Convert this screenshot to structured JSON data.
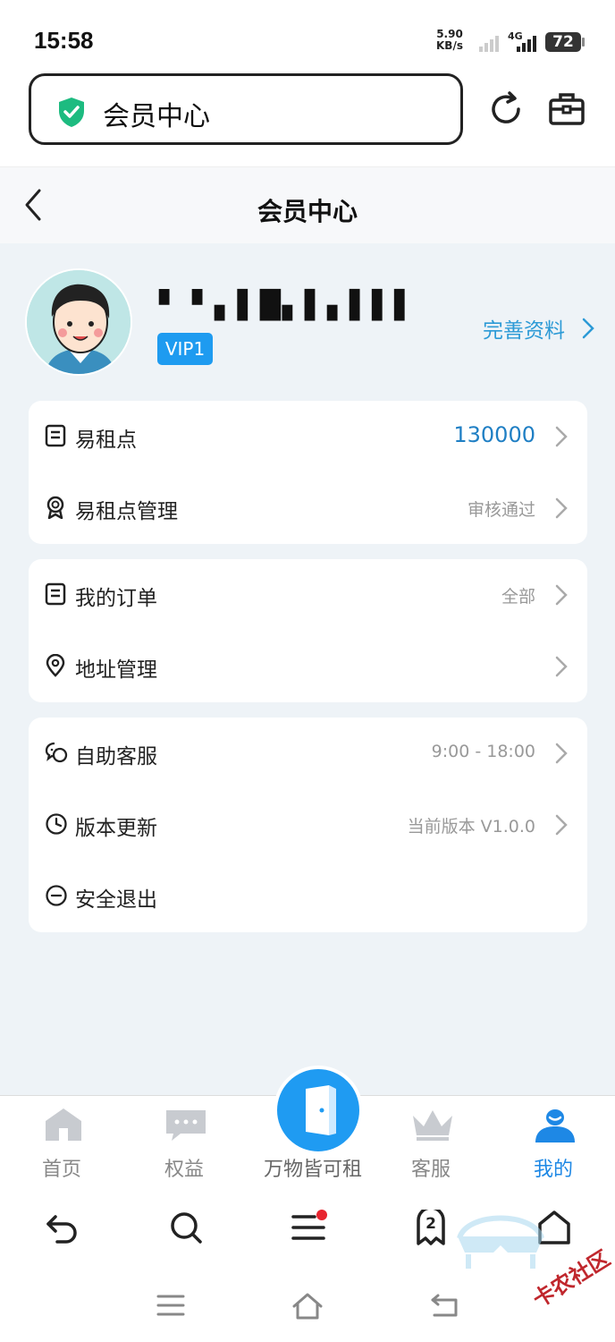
{
  "status_bar": {
    "time": "15:58",
    "speed_value": "5.90",
    "speed_unit": "KB/s",
    "network": "4G",
    "battery": "72"
  },
  "browser": {
    "address_text": "会员中心"
  },
  "header": {
    "title": "会员中心"
  },
  "profile": {
    "username": "▘▝▗ ▌█▖▌▖▌▌▌",
    "vip_badge": "VIP1",
    "complete_profile_link": "完善资料"
  },
  "card1": [
    {
      "label": "易租点",
      "value": "130000",
      "icon": "document-icon"
    },
    {
      "label": "易租点管理",
      "value": "审核通过",
      "icon": "badge-icon"
    }
  ],
  "card2": [
    {
      "label": "我的订单",
      "value": "全部",
      "icon": "document-icon"
    },
    {
      "label": "地址管理",
      "value": "",
      "icon": "location-icon"
    }
  ],
  "card3": [
    {
      "label": "自助客服",
      "value": "9:00 - 18:00",
      "icon": "chat-icon"
    },
    {
      "label": "版本更新",
      "value": "当前版本 V1.0.0",
      "icon": "clock-icon"
    },
    {
      "label": "安全退出",
      "value": "",
      "icon": "minus-circle-icon"
    }
  ],
  "tabbar": [
    {
      "label": "首页",
      "icon": "home-icon"
    },
    {
      "label": "权益",
      "icon": "message-icon"
    },
    {
      "label": "万物皆可租",
      "icon": "door-icon"
    },
    {
      "label": "客服",
      "icon": "crown-icon"
    },
    {
      "label": "我的",
      "icon": "user-icon",
      "active": true
    }
  ],
  "browser_toolbar": {
    "tabs_count": "2"
  },
  "watermark": "卡农社区",
  "colors": {
    "accent": "#1e9bf0",
    "link": "#2c9ad6",
    "page_bg": "#eef3f7"
  }
}
